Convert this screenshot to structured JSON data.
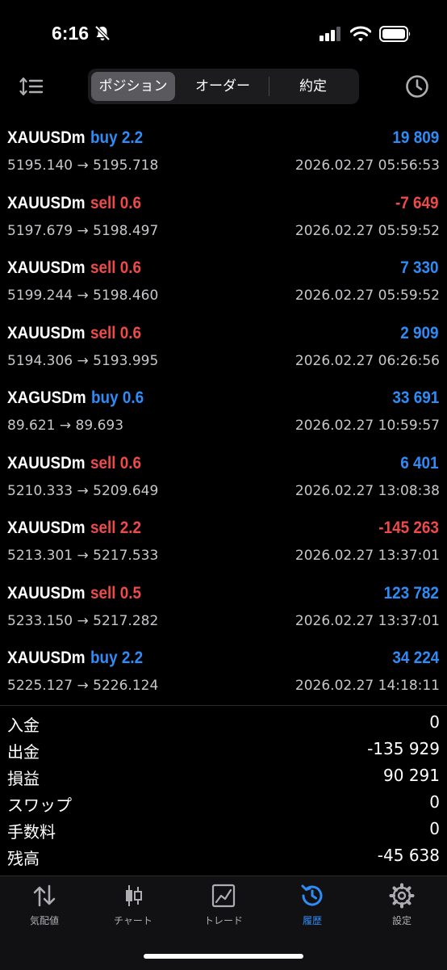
{
  "status_bar": {
    "time": "6:16",
    "icons": [
      "bell-slash-icon",
      "cellular-signal-icon",
      "wifi-icon",
      "battery-icon"
    ]
  },
  "toolbar": {
    "sort_icon": "sort-icon",
    "history_icon": "clock-icon",
    "segments": [
      {
        "label": "ポジション",
        "active": true
      },
      {
        "label": "オーダー",
        "active": false
      },
      {
        "label": "約定",
        "active": false
      }
    ]
  },
  "colors": {
    "buy": "#2f8cf7",
    "sell": "#ee4a4a",
    "positive": "#2f8cf7",
    "negative": "#ee4a4a",
    "accent": "#2f8cf7"
  },
  "deals": [
    {
      "symbol": "XAUUSDm",
      "side": "buy 2.2",
      "direction": "buy",
      "profit": "19 809",
      "profit_sign": "positive",
      "prices": "5195.140 → 5195.718",
      "time": "2026.02.27 05:56:53"
    },
    {
      "symbol": "XAUUSDm",
      "side": "sell 0.6",
      "direction": "sell",
      "profit": "-7 649",
      "profit_sign": "negative",
      "prices": "5197.679 → 5198.497",
      "time": "2026.02.27 05:59:52"
    },
    {
      "symbol": "XAUUSDm",
      "side": "sell 0.6",
      "direction": "sell",
      "profit": "7 330",
      "profit_sign": "positive",
      "prices": "5199.244 → 5198.460",
      "time": "2026.02.27 05:59:52"
    },
    {
      "symbol": "XAUUSDm",
      "side": "sell 0.6",
      "direction": "sell",
      "profit": "2 909",
      "profit_sign": "positive",
      "prices": "5194.306 → 5193.995",
      "time": "2026.02.27 06:26:56"
    },
    {
      "symbol": "XAGUSDm",
      "side": "buy 0.6",
      "direction": "buy",
      "profit": "33 691",
      "profit_sign": "positive",
      "prices": "89.621 → 89.693",
      "time": "2026.02.27 10:59:57"
    },
    {
      "symbol": "XAUUSDm",
      "side": "sell 0.6",
      "direction": "sell",
      "profit": "6 401",
      "profit_sign": "positive",
      "prices": "5210.333 → 5209.649",
      "time": "2026.02.27 13:08:38"
    },
    {
      "symbol": "XAUUSDm",
      "side": "sell 2.2",
      "direction": "sell",
      "profit": "-145 263",
      "profit_sign": "negative",
      "prices": "5213.301 → 5217.533",
      "time": "2026.02.27 13:37:01"
    },
    {
      "symbol": "XAUUSDm",
      "side": "sell 0.5",
      "direction": "sell",
      "profit": "123 782",
      "profit_sign": "positive",
      "prices": "5233.150 → 5217.282",
      "time": "2026.02.27 13:37:01"
    },
    {
      "symbol": "XAUUSDm",
      "side": "buy 2.2",
      "direction": "buy",
      "profit": "34 224",
      "profit_sign": "positive",
      "prices": "5225.127 → 5226.124",
      "time": "2026.02.27 14:18:11"
    }
  ],
  "summary": [
    {
      "label": "入金",
      "value": "0"
    },
    {
      "label": "出金",
      "value": "-135 929"
    },
    {
      "label": "損益",
      "value": "90 291"
    },
    {
      "label": "スワップ",
      "value": "0"
    },
    {
      "label": "手数料",
      "value": "0"
    },
    {
      "label": "残高",
      "value": "-45 638"
    }
  ],
  "tabbar": [
    {
      "label": "気配値",
      "icon": "quotes-arrows-icon",
      "active": false
    },
    {
      "label": "チャート",
      "icon": "candlestick-chart-icon",
      "active": false
    },
    {
      "label": "トレード",
      "icon": "trade-chart-icon",
      "active": false
    },
    {
      "label": "履歴",
      "icon": "history-icon",
      "active": true
    },
    {
      "label": "設定",
      "icon": "settings-gear-icon",
      "active": false
    }
  ]
}
